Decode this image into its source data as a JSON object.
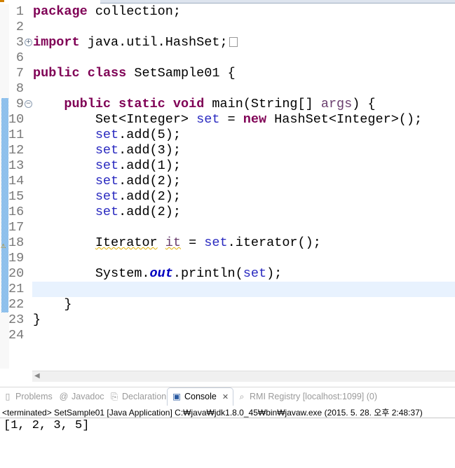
{
  "editor": {
    "lines": [
      {
        "n": "1",
        "parts": [
          [
            "k",
            "package"
          ],
          [
            "",
            " collection;"
          ]
        ]
      },
      {
        "n": "2",
        "parts": []
      },
      {
        "n": "3",
        "parts": [
          [
            "k",
            "import"
          ],
          [
            "",
            " java.util.HashSet;"
          ]
        ],
        "fold": "+",
        "collapsed": true
      },
      {
        "n": "6",
        "parts": []
      },
      {
        "n": "7",
        "parts": [
          [
            "k",
            "public"
          ],
          [
            "",
            " "
          ],
          [
            "k",
            "class"
          ],
          [
            "",
            " SetSample01 {"
          ]
        ]
      },
      {
        "n": "8",
        "parts": []
      },
      {
        "n": "9",
        "parts": [
          [
            "",
            "    "
          ],
          [
            "k",
            "public"
          ],
          [
            "",
            " "
          ],
          [
            "k",
            "static"
          ],
          [
            "",
            " "
          ],
          [
            "k",
            "void"
          ],
          [
            "",
            " main(String[] "
          ],
          [
            "a",
            "args"
          ],
          [
            "",
            ") {"
          ]
        ],
        "fold": "−"
      },
      {
        "n": "10",
        "parts": [
          [
            "",
            "        Set<Integer> "
          ],
          [
            "v",
            "set"
          ],
          [
            "",
            " = "
          ],
          [
            "k",
            "new"
          ],
          [
            "",
            " HashSet<Integer>();"
          ]
        ]
      },
      {
        "n": "11",
        "parts": [
          [
            "",
            "        "
          ],
          [
            "v",
            "set"
          ],
          [
            "",
            ".add(5);"
          ]
        ]
      },
      {
        "n": "12",
        "parts": [
          [
            "",
            "        "
          ],
          [
            "v",
            "set"
          ],
          [
            "",
            ".add(3);"
          ]
        ]
      },
      {
        "n": "13",
        "parts": [
          [
            "",
            "        "
          ],
          [
            "v",
            "set"
          ],
          [
            "",
            ".add(1);"
          ]
        ]
      },
      {
        "n": "14",
        "parts": [
          [
            "",
            "        "
          ],
          [
            "v",
            "set"
          ],
          [
            "",
            ".add(2);"
          ]
        ]
      },
      {
        "n": "15",
        "parts": [
          [
            "",
            "        "
          ],
          [
            "v",
            "set"
          ],
          [
            "",
            ".add(2);"
          ]
        ]
      },
      {
        "n": "16",
        "parts": [
          [
            "",
            "        "
          ],
          [
            "v",
            "set"
          ],
          [
            "",
            ".add(2);"
          ]
        ]
      },
      {
        "n": "17",
        "parts": []
      },
      {
        "n": "18",
        "parts": [
          [
            "",
            "        "
          ],
          [
            "w",
            "Iterator"
          ],
          [
            "",
            " "
          ],
          [
            "wa",
            "it"
          ],
          [
            "",
            " = "
          ],
          [
            "v",
            "set"
          ],
          [
            "",
            ".iterator();"
          ]
        ],
        "warning": true
      },
      {
        "n": "19",
        "parts": []
      },
      {
        "n": "20",
        "parts": [
          [
            "",
            "        System."
          ],
          [
            "f",
            "out"
          ],
          [
            "",
            ".println("
          ],
          [
            "v",
            "set"
          ],
          [
            "",
            ");"
          ]
        ]
      },
      {
        "n": "21",
        "parts": [],
        "current": true
      },
      {
        "n": "22",
        "parts": [
          [
            "",
            "    }"
          ]
        ]
      },
      {
        "n": "23",
        "parts": [
          [
            "",
            "}"
          ]
        ]
      },
      {
        "n": "24",
        "parts": []
      }
    ]
  },
  "panel": {
    "tabs": [
      {
        "label": "Problems",
        "icon": "problems-icon",
        "glyph": "▯"
      },
      {
        "label": "Javadoc",
        "icon": "at-icon",
        "glyph": "@"
      },
      {
        "label": "Declaration",
        "icon": "declaration-icon",
        "glyph": "⎘"
      },
      {
        "label": "Console",
        "icon": "console-icon",
        "glyph": "▣",
        "active": true
      },
      {
        "label": "RMI Registry [localhost:1099] (0)",
        "icon": "rmi-registry-icon",
        "glyph": "⌕"
      }
    ],
    "close_glyph": "✕",
    "status": "<terminated> SetSample01 [Java Application] C:₩java₩jdk1.8.0_45₩bin₩javaw.exe (2015. 5. 28. 오후 2:48:37)",
    "output": "[1, 2, 3, 5]"
  }
}
